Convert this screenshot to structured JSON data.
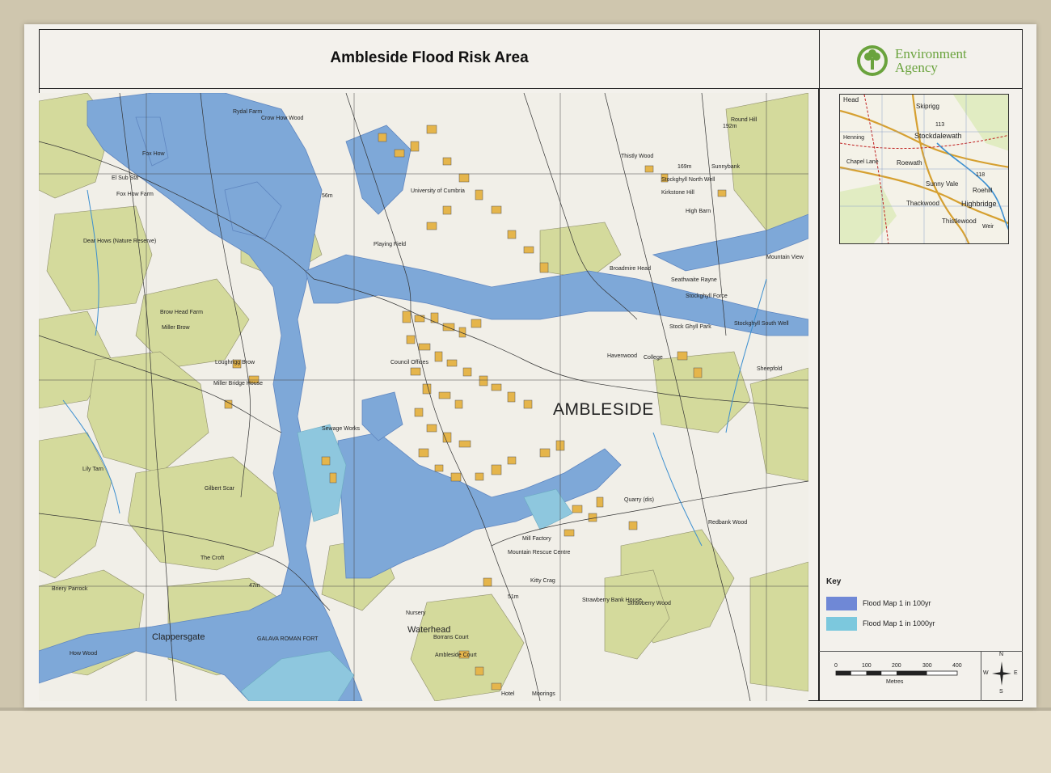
{
  "poster": {
    "title": "Ambleside Flood Risk Area",
    "organization": [
      "Environment",
      "Agency"
    ]
  },
  "map": {
    "town_label": "AMBLESIDE",
    "place_labels": {
      "waterhead": "Waterhead",
      "clappersgate": "Clappersgate",
      "rydal_farm": "Rydal Farm",
      "crow_how_wood": "Crow How Wood",
      "fox_how": "Fox How",
      "fox_how_farm": "Fox How Farm",
      "el_sub_sta": "El Sub Sta",
      "dear_hows": "Dear Hows (Nature Reserve)",
      "miller_brow": "Miller Brow",
      "brow_head_farm": "Brow Head Farm",
      "loughrigg_brow": "Loughrigg Brow",
      "miller_bridge_house": "Miller Bridge House",
      "lily_tarn": "Lily Tarn",
      "gilbert_scar": "Gilbert Scar",
      "the_croft": "The Croft",
      "briery_parrock": "Briery Parrock",
      "how_wood": "How Wood",
      "galava_roman_fort": "GALAVA ROMAN FORT",
      "university_of_cumbria": "University of Cumbria",
      "thistly_wood": "Thistly Wood",
      "stockghyll_north_well": "Stockghyll North Well",
      "kirkstone_hill": "Kirkstone Hill",
      "high_barn": "High Barn",
      "sunnybank": "Sunnybank",
      "broadmire_head": "Broadmire Head",
      "seathwaite_rayne": "Seathwaite Rayne",
      "stockghyll_force": "Stockghyll Force",
      "stock_ghyll_park": "Stock Ghyll Park",
      "stockghyll_south_well": "Stockghyll South Well",
      "havenwood": "Havenwood",
      "college": "College",
      "sheepfold": "Sheepfold",
      "quarry": "Quarry (dis)",
      "redbank_wood": "Redbank Wood",
      "mill_factory": "Mill Factory",
      "mountain_rescue_centre": "Mountain Rescue Centre",
      "kitty_crag": "Kitty Crag",
      "strawberry_bank_house": "Strawberry Bank House",
      "strawberry_wood": "Strawberry Wood",
      "nursery": "Nursery",
      "borrans_court": "Borrans Court",
      "ambleside_court": "Ambleside Court",
      "moorings": "Moorings",
      "hotel": "Hotel",
      "playing_field": "Playing Field",
      "sewage_works": "Sewage Works",
      "council_offices": "Council Offices",
      "round_hill": "Round Hill",
      "mountain_view": "Mountain View",
      "height_192": "192m",
      "height_169": "169m",
      "height_56": "56m",
      "height_47": "47m",
      "height_51": "51m"
    }
  },
  "inset": {
    "labels": {
      "skiprigg": "Skiprigg",
      "stockdalewath": "Stockdalewath",
      "hennings": "Henning",
      "chapel_lane": "Chapel Lane",
      "roewath": "Roewath",
      "sunny_vale": "Sunny Vale",
      "roehill": "Roehill",
      "highbridge": "Highbridge",
      "thackwood": "Thackwood",
      "thistlewood": "Thistlewood",
      "head": "Head",
      "weir": "Weir",
      "num_113": "113",
      "num_118": "118"
    }
  },
  "legend": {
    "title": "Key",
    "items": [
      {
        "label": "Flood Map 1 in 100yr",
        "color": "#6f88d6"
      },
      {
        "label": "Flood Map 1 in 1000yr",
        "color": "#7cc8dd"
      }
    ]
  },
  "scale_bar": {
    "ticks": [
      "0",
      "100",
      "200",
      "300",
      "400"
    ],
    "unit": "Metres"
  },
  "compass": {
    "n": "N",
    "s": "S",
    "e": "E",
    "w": "W"
  },
  "colors": {
    "flood_100yr": "#7ea8d8",
    "flood_1000yr": "#8ec7de",
    "woodland": "#d4da9c",
    "buildings": "#e5b54b",
    "logo_green": "#6aa33d"
  }
}
